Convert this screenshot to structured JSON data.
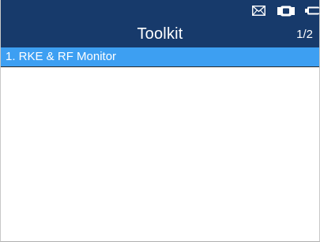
{
  "status_bar": {
    "icons": [
      "envelope-icon",
      "vci-connection-icon",
      "battery-icon"
    ]
  },
  "header": {
    "title": "Toolkit",
    "page_indicator": "1/2"
  },
  "menu": {
    "items": [
      {
        "label": "1. RKE & RF Monitor",
        "selected": true
      }
    ]
  },
  "colors": {
    "header_bg": "#173a6b",
    "selected_bg": "#3d9ff2",
    "text_light": "#ffffff"
  }
}
